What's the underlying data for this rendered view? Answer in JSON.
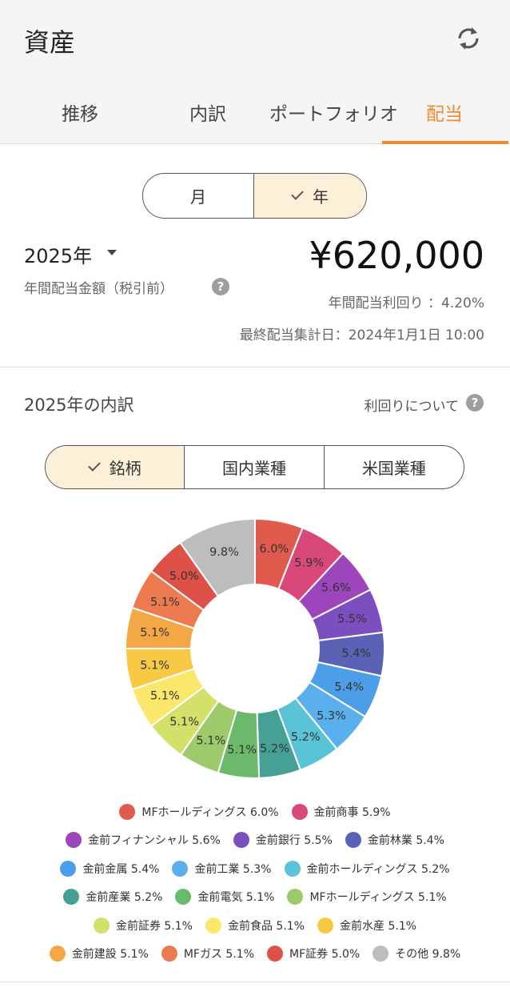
{
  "header": {
    "title": "資産",
    "tabs": [
      {
        "label": "推移"
      },
      {
        "label": "内訳"
      },
      {
        "label": "ポートフォリオ"
      },
      {
        "label": "配当"
      }
    ]
  },
  "period_toggle": {
    "month": "月",
    "year": "年"
  },
  "summary": {
    "year": "2025年",
    "label": "年間配当金額（税引前）",
    "amount": "¥620,000",
    "yield": "年間配当利回り ：4.20%",
    "updated": "最終配当集計日：2024年1月1日 10:00"
  },
  "breakdown": {
    "title": "2025年の内訳",
    "about_yield": "利回りについて",
    "tabs": [
      "銘柄",
      "国内業種",
      "米国業種"
    ]
  },
  "chart_data": {
    "type": "pie",
    "donut": true,
    "unit": "%",
    "slices": [
      {
        "name": "MFホールディングス",
        "value": 6.0,
        "label": "6.0%",
        "color": "#e05a4e"
      },
      {
        "name": "金前商事",
        "value": 5.9,
        "label": "5.9%",
        "color": "#d9487a"
      },
      {
        "name": "金前フィナンシャル",
        "value": 5.6,
        "label": "5.6%",
        "color": "#9d45bb"
      },
      {
        "name": "金前銀行",
        "value": 5.5,
        "label": "5.5%",
        "color": "#7b4fc0"
      },
      {
        "name": "金前林業",
        "value": 5.4,
        "label": "5.4%",
        "color": "#5a62b5"
      },
      {
        "name": "金前金属",
        "value": 5.4,
        "label": "5.4%",
        "color": "#4c9ee8"
      },
      {
        "name": "金前工業",
        "value": 5.3,
        "label": "5.3%",
        "color": "#5ab0ec"
      },
      {
        "name": "金前ホールディングス",
        "value": 5.2,
        "label": "5.2%",
        "color": "#5bc3d6"
      },
      {
        "name": "金前産業",
        "value": 5.2,
        "label": "5.2%",
        "color": "#45a196"
      },
      {
        "name": "金前電気",
        "value": 5.1,
        "label": "5.1%",
        "color": "#6bb96a"
      },
      {
        "name": "MFホールディングス",
        "value": 5.1,
        "label": "5.1%",
        "color": "#9dca6a"
      },
      {
        "name": "金前証券",
        "value": 5.1,
        "label": "5.1%",
        "color": "#d3e06a"
      },
      {
        "name": "金前食品",
        "value": 5.1,
        "label": "5.1%",
        "color": "#fbe76b"
      },
      {
        "name": "金前水産",
        "value": 5.1,
        "label": "5.1%",
        "color": "#f7c944"
      },
      {
        "name": "金前建設",
        "value": 5.1,
        "label": "5.1%",
        "color": "#f3a845"
      },
      {
        "name": "MFガス",
        "value": 5.1,
        "label": "5.1%",
        "color": "#ee7b4f"
      },
      {
        "name": "MF証券",
        "value": 5.0,
        "label": "5.0%",
        "color": "#dd5148"
      },
      {
        "name": "その他",
        "value": 9.8,
        "label": "9.8%",
        "color": "#bdbdbd"
      }
    ]
  },
  "legend_rows": [
    [
      {
        "text": "MFホールディングス 6.0%",
        "color": "#e05a4e"
      },
      {
        "text": "金前商事 5.9%",
        "color": "#d9487a"
      }
    ],
    [
      {
        "text": "金前フィナンシャル 5.6%",
        "color": "#9d45bb"
      },
      {
        "text": "金前銀行 5.5%",
        "color": "#7b4fc0"
      },
      {
        "text": "金前林業 5.4%",
        "color": "#5a62b5"
      }
    ],
    [
      {
        "text": "金前金属 5.4%",
        "color": "#4c9ee8"
      },
      {
        "text": "金前工業 5.3%",
        "color": "#5ab0ec"
      },
      {
        "text": "金前ホールディングス 5.2%",
        "color": "#5bc3d6"
      }
    ],
    [
      {
        "text": "金前産業 5.2%",
        "color": "#45a196"
      },
      {
        "text": "金前電気 5.1%",
        "color": "#6bb96a"
      },
      {
        "text": "MFホールディングス 5.1%",
        "color": "#9dca6a"
      }
    ],
    [
      {
        "text": "金前証券 5.1%",
        "color": "#d3e06a"
      },
      {
        "text": "金前食品 5.1%",
        "color": "#fbe76b"
      },
      {
        "text": "金前水産 5.1%",
        "color": "#f7c944"
      }
    ],
    [
      {
        "text": "金前建設 5.1%",
        "color": "#f3a845"
      },
      {
        "text": "MFガス 5.1%",
        "color": "#ee7b4f"
      },
      {
        "text": "MF証券 5.0%",
        "color": "#dd5148"
      },
      {
        "text": "その他 9.8%",
        "color": "#bdbdbd"
      }
    ]
  ],
  "icons": {
    "refresh": "refresh-icon",
    "help": "help-circle-icon",
    "dropdown": "caret-down-icon",
    "check": "check-icon"
  },
  "colors": {
    "accent": "#ef8a2e",
    "selected_bg": "#fdf0d8"
  }
}
